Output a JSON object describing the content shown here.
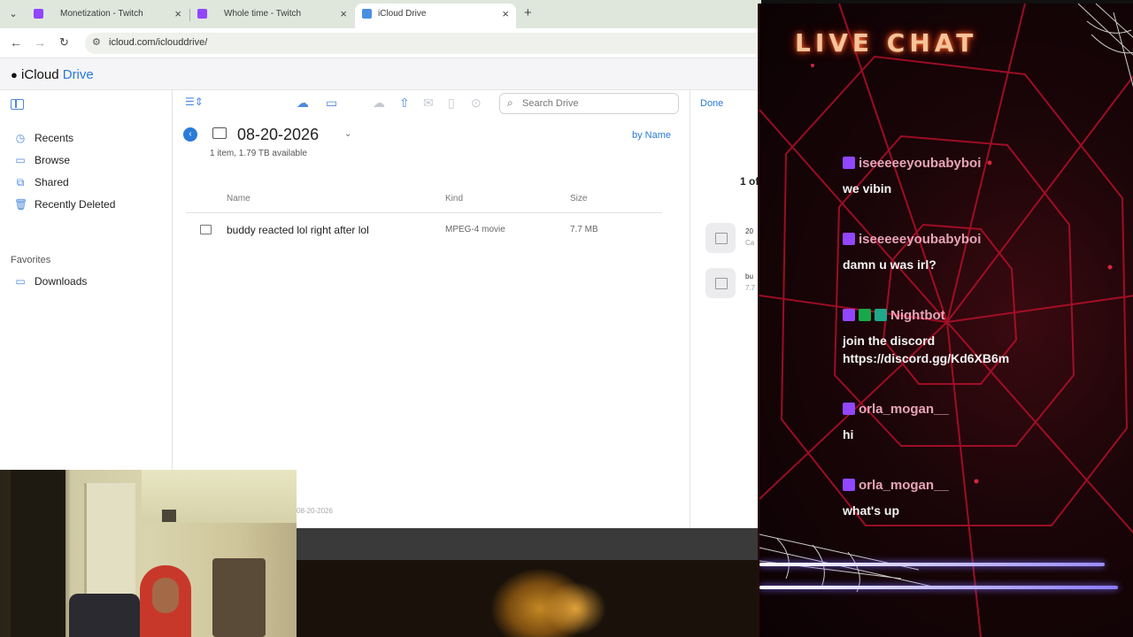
{
  "browser": {
    "tabs": [
      {
        "label": "Monetization - Twitch",
        "active": false
      },
      {
        "label": "Whole time - Twitch",
        "active": false
      },
      {
        "label": "iCloud Drive",
        "active": true
      }
    ],
    "url": "icloud.com/iclouddrive/"
  },
  "icloud": {
    "brand": {
      "apple": "",
      "icloud": "iCloud",
      "drive": "Drive"
    },
    "sidebar": {
      "items": [
        {
          "label": "Recents",
          "icon": "clock-icon"
        },
        {
          "label": "Browse",
          "icon": "folder-icon"
        },
        {
          "label": "Shared",
          "icon": "shared-folder-icon"
        },
        {
          "label": "Recently Deleted",
          "icon": "trash-icon"
        }
      ],
      "favorites_heading": "Favorites",
      "favorites": [
        {
          "label": "Downloads",
          "icon": "folder-icon"
        }
      ]
    },
    "search_placeholder": "Search Drive",
    "folder": {
      "title": "08-20-2026",
      "subtitle": "1 item, 1.79 TB available",
      "sort": "by Name",
      "columns": {
        "name": "Name",
        "kind": "Kind",
        "size": "Size"
      },
      "rows": [
        {
          "name": "buddy reacted lol right after lol",
          "kind": "MPEG-4 movie",
          "size": "7.7 MB"
        }
      ],
      "footer": "08-20-2026"
    },
    "right_panel": {
      "done": "Done",
      "counter": "1 of",
      "items": [
        {
          "line1": "20",
          "line2": "Ca"
        },
        {
          "line1": "bu",
          "line2": "7.7"
        }
      ]
    }
  },
  "chat": {
    "title": "LIVE CHAT",
    "accent": "#f6c39a",
    "messages": [
      {
        "user": "iseeeeeyoubabyboi",
        "text": "we vibin",
        "badges": [
          "twitch"
        ]
      },
      {
        "user": "iseeeeeyoubabyboi",
        "text": "damn u was irl?",
        "badges": [
          "twitch"
        ]
      },
      {
        "user": "Nightbot",
        "text": "join the discord",
        "text2": "https://discord.gg/Kd6XB6m",
        "badges": [
          "twitch",
          "verified",
          "bot"
        ]
      },
      {
        "user": "orla_mogan__",
        "text": "hi",
        "badges": [
          "twitch"
        ]
      },
      {
        "user": "orla_mogan__",
        "text": "what's up",
        "badges": [
          "twitch"
        ]
      }
    ]
  }
}
